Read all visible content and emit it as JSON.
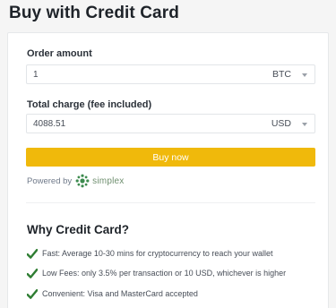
{
  "page": {
    "title": "Buy with Credit Card"
  },
  "order": {
    "label": "Order amount",
    "value": "1",
    "currency": "BTC"
  },
  "charge": {
    "label": "Total charge (fee included)",
    "value": "4088.51",
    "currency": "USD"
  },
  "buy_button": {
    "label": "Buy now"
  },
  "powered": {
    "prefix": "Powered by",
    "brand": "simplex"
  },
  "why": {
    "title": "Why Credit Card?",
    "items": [
      {
        "text": "Fast: Average 10-30 mins for cryptocurrency to reach your wallet"
      },
      {
        "text": "Low Fees: only 3.5% per transaction or 10 USD, whichever is higher"
      },
      {
        "text": "Convenient: Visa and MasterCard accepted"
      }
    ]
  },
  "colors": {
    "accent": "#f0b90b",
    "check": "#2e7d32",
    "brand_logo": "#3d8b4f"
  },
  "icons": {
    "dropdown": "chevron-down-icon",
    "check": "check-icon",
    "simplex": "simplex-logo-icon"
  }
}
